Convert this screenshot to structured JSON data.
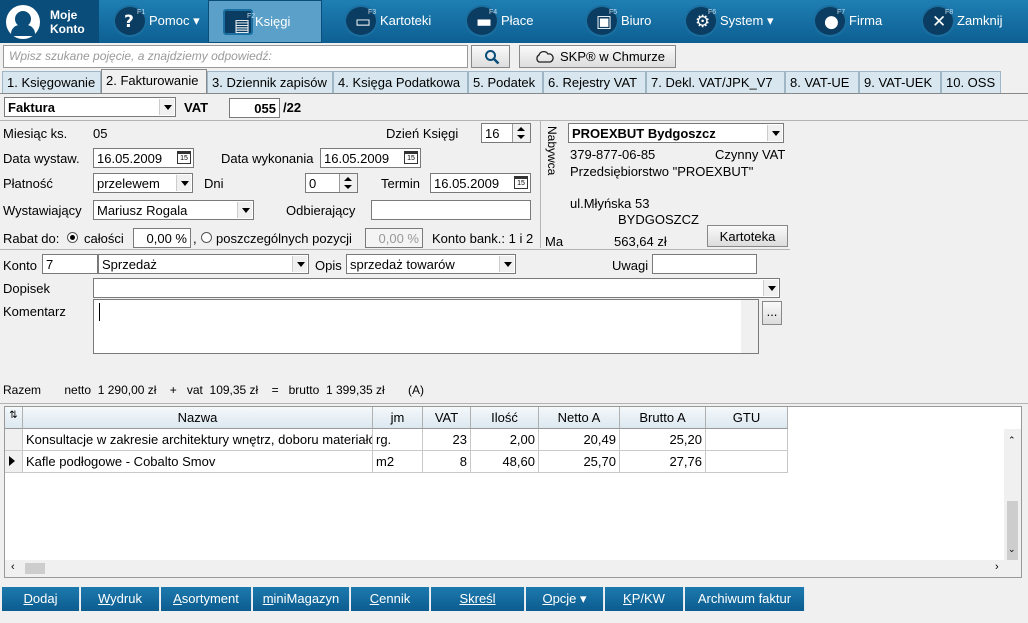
{
  "topbar": {
    "logo": "Moje Konto",
    "buttons": [
      {
        "key": "F1",
        "icon": "help-icon",
        "glyph": "?",
        "label": "Pomoc ▾"
      },
      {
        "key": "F2",
        "icon": "book-icon",
        "glyph": "▤",
        "label": "Księgi"
      },
      {
        "key": "F3",
        "icon": "folder-icon",
        "glyph": "▭",
        "label": "Kartoteki"
      },
      {
        "key": "F4",
        "icon": "wallet-icon",
        "glyph": "▬",
        "label": "Płace"
      },
      {
        "key": "F5",
        "icon": "briefcase-icon",
        "glyph": "▣",
        "label": "Biuro"
      },
      {
        "key": "F6",
        "icon": "gears-icon",
        "glyph": "⚙",
        "label": "System ▾"
      },
      {
        "key": "F7",
        "icon": "person-icon",
        "glyph": "●",
        "label": "Firma"
      },
      {
        "key": "F8",
        "icon": "close-icon",
        "glyph": "✕",
        "label": "Zamknij"
      }
    ]
  },
  "search": {
    "placeholder": "Wpisz szukane pojęcie, a znajdziemy odpowiedź:",
    "skp_label": "SKP® w Chmurze"
  },
  "tabs": [
    "1. Księgowanie",
    "2. Fakturowanie",
    "3. Dziennik zapisów",
    "4. Księga Podatkowa",
    "5. Podatek",
    "6. Rejestry VAT",
    "7. Dekl. VAT/JPK_V7",
    "8. VAT-UE",
    "9. VAT-UEK",
    "10. OSS"
  ],
  "doc": {
    "type": "Faktura",
    "vat_label": "VAT",
    "number": "055",
    "suffix": "/22"
  },
  "form": {
    "miesiac_label": "Miesiąc ks.",
    "miesiac": "05",
    "dzien_label": "Dzień Księgi",
    "dzien": "16",
    "data_wystaw_label": "Data wystaw.",
    "data_wystaw": "16.05.2009",
    "data_wyk_label": "Data wykonania",
    "data_wyk": "16.05.2009",
    "platnosc_label": "Płatność",
    "platnosc": "przelewem",
    "dni_label": "Dni",
    "dni": "0",
    "termin_label": "Termin",
    "termin": "16.05.2009",
    "wystawiajacy_label": "Wystawiający",
    "wystawiajacy": "Mariusz Rogala",
    "odbierajacy_label": "Odbierający",
    "odbierajacy": "",
    "rabat_label": "Rabat do:",
    "rabat_calosci": "całości",
    "rabat_val1": "0,00 %",
    "rabat_sep": ",",
    "rabat_pozycji": "poszczególnych pozycji",
    "rabat_val2": "0,00 %",
    "konto_bank": "Konto bank.: 1 i 2",
    "konto_label": "Konto",
    "konto_nr": "7",
    "konto_name": "Sprzedaż",
    "opis_label": "Opis",
    "opis": "sprzedaż towarów",
    "uwagi_label": "Uwagi",
    "uwagi": "",
    "dopisek_label": "Dopisek",
    "dopisek": "",
    "komentarz_label": "Komentarz",
    "komentarz": "",
    "more_button": "..."
  },
  "buyer": {
    "side_label": "Nabywca",
    "name": "PROEXBUT Bydgoszcz",
    "nip": "379-877-06-85",
    "vat_status": "Czynny VAT",
    "fullname": "Przedsiębiorstwo \"PROEXBUT\"",
    "street": "ul.Młyńska 53",
    "city": "BYDGOSZCZ",
    "ma_label": "Ma",
    "ma_value": "563,64 zł",
    "kartoteka": "Kartoteka"
  },
  "totals": {
    "razem": "Razem",
    "netto_label": "netto",
    "netto": "1 290,00 zł",
    "plus": "+",
    "vat_label": "vat",
    "vat": "109,35 zł",
    "eq": "=",
    "brutto_label": "brutto",
    "brutto": "1 399,35 zł",
    "flag": "(A)"
  },
  "grid": {
    "columns": [
      "Nazwa",
      "jm",
      "VAT",
      "Ilość",
      "Netto A",
      "Brutto A",
      "GTU"
    ],
    "rows": [
      [
        "Konsultacje w zakresie architektury wnętrz, doboru materiałów",
        "rg.",
        "23",
        "2,00",
        "20,49",
        "25,20",
        ""
      ],
      [
        "Kafle podłogowe - Cobalto Smov",
        "m2",
        "8",
        "48,60",
        "25,70",
        "27,76",
        ""
      ]
    ]
  },
  "bottom": [
    {
      "u": "D",
      "rest": "odaj",
      "name": "dodaj-button"
    },
    {
      "u": "W",
      "rest": "ydruk",
      "name": "wydruk-button"
    },
    {
      "u": "A",
      "rest": "sortyment",
      "name": "asortyment-button"
    },
    {
      "u": "m",
      "rest": "iniMagazyn",
      "name": "minimagazyn-button"
    },
    {
      "u": "C",
      "rest": "ennik",
      "name": "cennik-button"
    },
    {
      "u": "Skreśl",
      "rest": "",
      "name": "skresl-button"
    },
    {
      "u": "O",
      "rest": "pcje ▾",
      "name": "opcje-button"
    },
    {
      "u": "K",
      "rest": "P/KW",
      "name": "kpkw-button"
    },
    {
      "u": "",
      "rest": "Archiwum faktur",
      "name": "archiwum-button"
    }
  ]
}
